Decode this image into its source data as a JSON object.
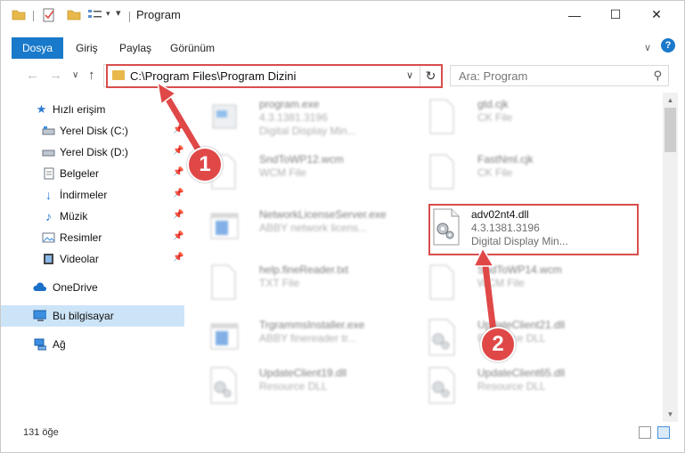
{
  "window": {
    "title": "Program",
    "minimize_glyph": "—",
    "maximize_glyph": "☐",
    "close_glyph": "✕"
  },
  "ribbon": {
    "tabs": [
      "Dosya",
      "Giriş",
      "Paylaş",
      "Görünüm"
    ],
    "collapse_glyph": "∨",
    "help_glyph": "?"
  },
  "navigation": {
    "back_glyph": "←",
    "forward_glyph": "→",
    "recent_glyph": "∨",
    "up_glyph": "↑"
  },
  "address": {
    "path": "C:\\Program Files\\Program Dizini",
    "dropdown_glyph": "∨",
    "refresh_glyph": "↻"
  },
  "search": {
    "placeholder": "Ara: Program",
    "icon_glyph": "⚲"
  },
  "sidebar": {
    "items": [
      {
        "label": "Hızlı erişim",
        "icon": "star-icon",
        "pinned": false
      },
      {
        "label": "Yerel Disk (C:)",
        "icon": "drive-icon",
        "pinned": true
      },
      {
        "label": "Yerel Disk (D:)",
        "icon": "drive-icon",
        "pinned": true
      },
      {
        "label": "Belgeler",
        "icon": "document-icon",
        "pinned": true
      },
      {
        "label": "İndirmeler",
        "icon": "download-icon",
        "pinned": true
      },
      {
        "label": "Müzik",
        "icon": "music-icon",
        "pinned": true
      },
      {
        "label": "Resimler",
        "icon": "picture-icon",
        "pinned": true
      },
      {
        "label": "Videolar",
        "icon": "video-icon",
        "pinned": true
      },
      {
        "label": "OneDrive",
        "icon": "cloud-icon",
        "pinned": false
      },
      {
        "label": "Bu bilgisayar",
        "icon": "computer-icon",
        "pinned": false,
        "selected": true
      },
      {
        "label": "Ağ",
        "icon": "network-icon",
        "pinned": false
      }
    ],
    "pin_glyph": "📌"
  },
  "files": [
    {
      "name": "program.exe",
      "line2": "4.3.1381.3196",
      "line3": "Digital Display Min...",
      "icon": "exe-icon"
    },
    {
      "name": "gtd.cjk",
      "line2": "CK File",
      "line3": "",
      "icon": "blank-file-icon"
    },
    {
      "name": "SndToWP12.wcm",
      "line2": "WCM File",
      "line3": "",
      "icon": "blank-file-icon"
    },
    {
      "name": "FastNml.cjk",
      "line2": "CK File",
      "line3": "",
      "icon": "blank-file-icon"
    },
    {
      "name": "NetworkLicenseServer.exe",
      "line2": "ABBY network licens...",
      "line3": "",
      "icon": "window-app-icon"
    },
    {
      "name": "adv02nt4.dll",
      "line2": "4.3.1381.3196",
      "line3": "Digital Display Min...",
      "icon": "dll-gear-icon"
    },
    {
      "name": "help.fineReader.txt",
      "line2": "TXT File",
      "line3": "",
      "icon": "blank-file-icon"
    },
    {
      "name": "SndToWP14.wcm",
      "line2": "WCM File",
      "line3": "",
      "icon": "blank-file-icon"
    },
    {
      "name": "TrgrammsInstaller.exe",
      "line2": "ABBY finereader tr...",
      "line3": "",
      "icon": "window-app-icon"
    },
    {
      "name": "UpdateClient21.dll",
      "line2": "Resource DLL",
      "line3": "",
      "icon": "dll-gear-icon"
    },
    {
      "name": "UpdateClient19.dll",
      "line2": "Resource DLL",
      "line3": "",
      "icon": "dll-gear-icon"
    },
    {
      "name": "UpdateClient65.dll",
      "line2": "Resource DLL",
      "line3": "",
      "icon": "dll-gear-icon"
    }
  ],
  "status": {
    "count": "131 öğe"
  },
  "callouts": [
    {
      "label": "1"
    },
    {
      "label": "2"
    }
  ],
  "colors": {
    "accent": "#1979ca",
    "highlight": "#d94d4d",
    "selected_nav": "#cce4f7",
    "folder": "#e8b84a"
  }
}
